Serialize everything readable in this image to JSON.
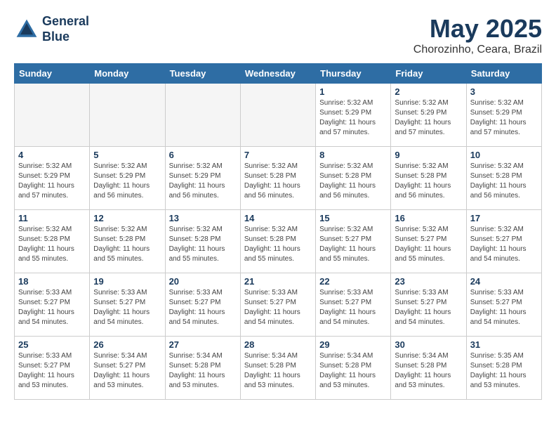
{
  "header": {
    "logo_line1": "General",
    "logo_line2": "Blue",
    "month_title": "May 2025",
    "location": "Chorozinho, Ceara, Brazil"
  },
  "days_of_week": [
    "Sunday",
    "Monday",
    "Tuesday",
    "Wednesday",
    "Thursday",
    "Friday",
    "Saturday"
  ],
  "weeks": [
    [
      {
        "day": "",
        "info": ""
      },
      {
        "day": "",
        "info": ""
      },
      {
        "day": "",
        "info": ""
      },
      {
        "day": "",
        "info": ""
      },
      {
        "day": "1",
        "info": "Sunrise: 5:32 AM\nSunset: 5:29 PM\nDaylight: 11 hours\nand 57 minutes."
      },
      {
        "day": "2",
        "info": "Sunrise: 5:32 AM\nSunset: 5:29 PM\nDaylight: 11 hours\nand 57 minutes."
      },
      {
        "day": "3",
        "info": "Sunrise: 5:32 AM\nSunset: 5:29 PM\nDaylight: 11 hours\nand 57 minutes."
      }
    ],
    [
      {
        "day": "4",
        "info": "Sunrise: 5:32 AM\nSunset: 5:29 PM\nDaylight: 11 hours\nand 57 minutes."
      },
      {
        "day": "5",
        "info": "Sunrise: 5:32 AM\nSunset: 5:29 PM\nDaylight: 11 hours\nand 56 minutes."
      },
      {
        "day": "6",
        "info": "Sunrise: 5:32 AM\nSunset: 5:29 PM\nDaylight: 11 hours\nand 56 minutes."
      },
      {
        "day": "7",
        "info": "Sunrise: 5:32 AM\nSunset: 5:28 PM\nDaylight: 11 hours\nand 56 minutes."
      },
      {
        "day": "8",
        "info": "Sunrise: 5:32 AM\nSunset: 5:28 PM\nDaylight: 11 hours\nand 56 minutes."
      },
      {
        "day": "9",
        "info": "Sunrise: 5:32 AM\nSunset: 5:28 PM\nDaylight: 11 hours\nand 56 minutes."
      },
      {
        "day": "10",
        "info": "Sunrise: 5:32 AM\nSunset: 5:28 PM\nDaylight: 11 hours\nand 56 minutes."
      }
    ],
    [
      {
        "day": "11",
        "info": "Sunrise: 5:32 AM\nSunset: 5:28 PM\nDaylight: 11 hours\nand 55 minutes."
      },
      {
        "day": "12",
        "info": "Sunrise: 5:32 AM\nSunset: 5:28 PM\nDaylight: 11 hours\nand 55 minutes."
      },
      {
        "day": "13",
        "info": "Sunrise: 5:32 AM\nSunset: 5:28 PM\nDaylight: 11 hours\nand 55 minutes."
      },
      {
        "day": "14",
        "info": "Sunrise: 5:32 AM\nSunset: 5:28 PM\nDaylight: 11 hours\nand 55 minutes."
      },
      {
        "day": "15",
        "info": "Sunrise: 5:32 AM\nSunset: 5:27 PM\nDaylight: 11 hours\nand 55 minutes."
      },
      {
        "day": "16",
        "info": "Sunrise: 5:32 AM\nSunset: 5:27 PM\nDaylight: 11 hours\nand 55 minutes."
      },
      {
        "day": "17",
        "info": "Sunrise: 5:32 AM\nSunset: 5:27 PM\nDaylight: 11 hours\nand 54 minutes."
      }
    ],
    [
      {
        "day": "18",
        "info": "Sunrise: 5:33 AM\nSunset: 5:27 PM\nDaylight: 11 hours\nand 54 minutes."
      },
      {
        "day": "19",
        "info": "Sunrise: 5:33 AM\nSunset: 5:27 PM\nDaylight: 11 hours\nand 54 minutes."
      },
      {
        "day": "20",
        "info": "Sunrise: 5:33 AM\nSunset: 5:27 PM\nDaylight: 11 hours\nand 54 minutes."
      },
      {
        "day": "21",
        "info": "Sunrise: 5:33 AM\nSunset: 5:27 PM\nDaylight: 11 hours\nand 54 minutes."
      },
      {
        "day": "22",
        "info": "Sunrise: 5:33 AM\nSunset: 5:27 PM\nDaylight: 11 hours\nand 54 minutes."
      },
      {
        "day": "23",
        "info": "Sunrise: 5:33 AM\nSunset: 5:27 PM\nDaylight: 11 hours\nand 54 minutes."
      },
      {
        "day": "24",
        "info": "Sunrise: 5:33 AM\nSunset: 5:27 PM\nDaylight: 11 hours\nand 54 minutes."
      }
    ],
    [
      {
        "day": "25",
        "info": "Sunrise: 5:33 AM\nSunset: 5:27 PM\nDaylight: 11 hours\nand 53 minutes."
      },
      {
        "day": "26",
        "info": "Sunrise: 5:34 AM\nSunset: 5:27 PM\nDaylight: 11 hours\nand 53 minutes."
      },
      {
        "day": "27",
        "info": "Sunrise: 5:34 AM\nSunset: 5:28 PM\nDaylight: 11 hours\nand 53 minutes."
      },
      {
        "day": "28",
        "info": "Sunrise: 5:34 AM\nSunset: 5:28 PM\nDaylight: 11 hours\nand 53 minutes."
      },
      {
        "day": "29",
        "info": "Sunrise: 5:34 AM\nSunset: 5:28 PM\nDaylight: 11 hours\nand 53 minutes."
      },
      {
        "day": "30",
        "info": "Sunrise: 5:34 AM\nSunset: 5:28 PM\nDaylight: 11 hours\nand 53 minutes."
      },
      {
        "day": "31",
        "info": "Sunrise: 5:35 AM\nSunset: 5:28 PM\nDaylight: 11 hours\nand 53 minutes."
      }
    ]
  ]
}
